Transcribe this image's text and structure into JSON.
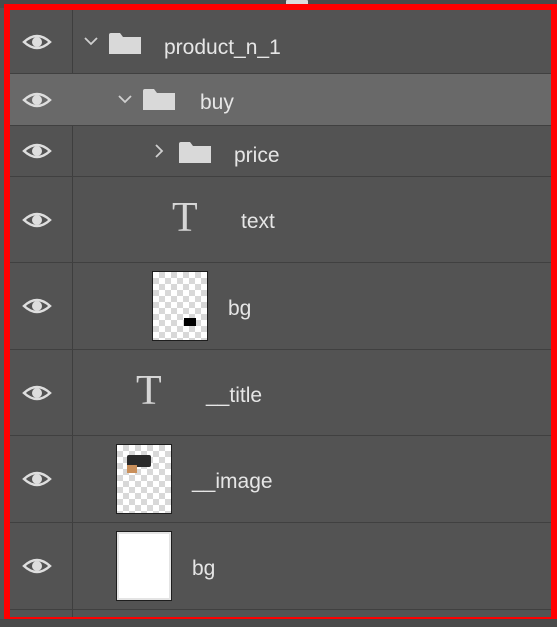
{
  "colors": {
    "panel_bg": "#535353",
    "selected_row_bg": "#696969",
    "highlight_border": "#ff0000",
    "text": "#e6e6e6"
  },
  "layers": [
    {
      "name": "product_n_1",
      "type": "group",
      "expanded": true,
      "visible": true
    },
    {
      "name": "buy",
      "type": "group",
      "expanded": true,
      "visible": true,
      "selected": true
    },
    {
      "name": "price",
      "type": "group",
      "expanded": false,
      "visible": true
    },
    {
      "name": "text",
      "type": "text",
      "visible": true
    },
    {
      "name": "bg",
      "type": "pixel",
      "visible": true
    },
    {
      "name": "__title",
      "type": "text",
      "visible": true
    },
    {
      "name": "__image",
      "type": "pixel",
      "visible": true
    },
    {
      "name": "bg",
      "type": "pixel",
      "visible": true
    }
  ]
}
